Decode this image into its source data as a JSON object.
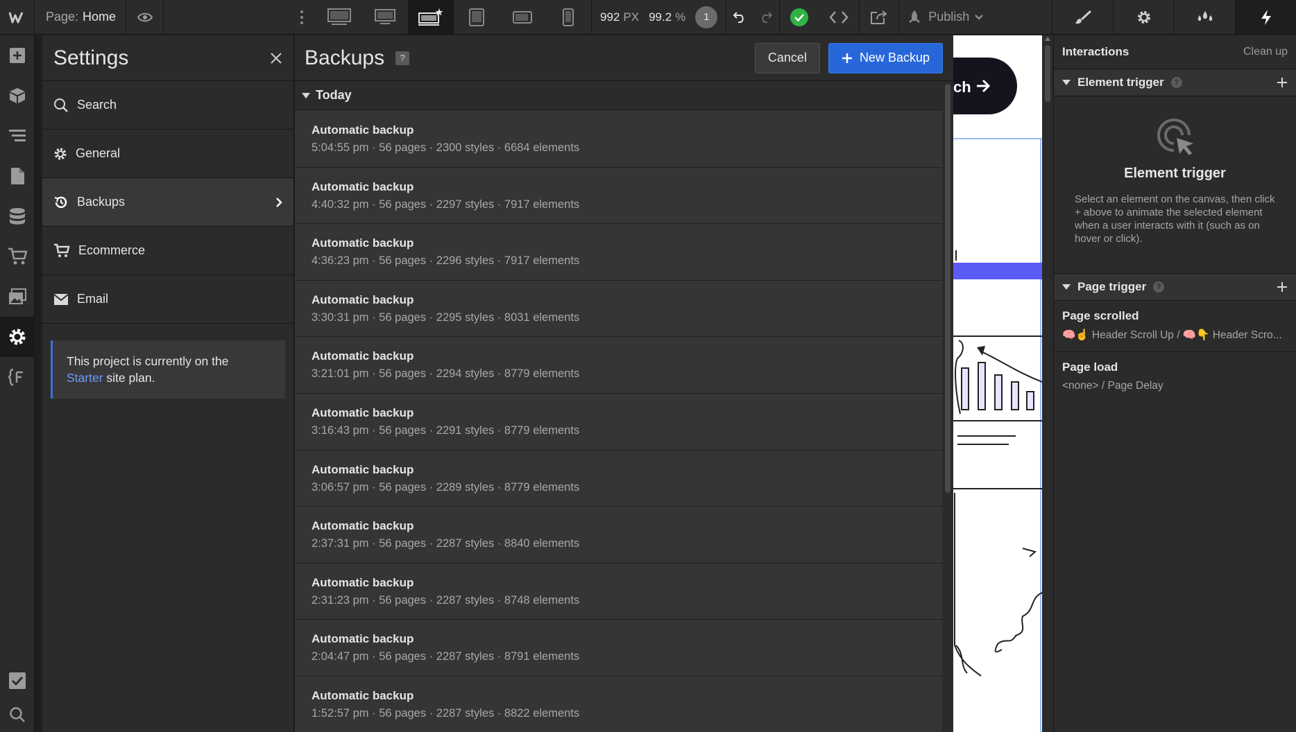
{
  "topbar": {
    "page_label": "Page:",
    "page_name": "Home",
    "width_value": "992",
    "width_unit": "PX",
    "zoom_value": "99.2",
    "zoom_unit": "%",
    "badge_count": "1",
    "publish_label": "Publish",
    "devices": [
      "desktop-large-icon",
      "desktop-icon",
      "desktop-base-icon",
      "tablet-icon",
      "mobile-landscape-icon",
      "mobile-portrait-icon"
    ],
    "active_device": "desktop-base-icon"
  },
  "rail": {
    "items": [
      "add-icon",
      "components-icon",
      "navigator-icon",
      "pages-icon",
      "cms-icon",
      "ecommerce-icon",
      "assets-icon",
      "settings-icon",
      "variables-icon"
    ],
    "bottom": [
      "audit-check-icon",
      "search-icon"
    ]
  },
  "settings": {
    "title": "Settings",
    "items": [
      {
        "label": "Search",
        "icon": "search-icon"
      },
      {
        "label": "General",
        "icon": "gear-icon"
      },
      {
        "label": "Backups",
        "icon": "history-icon",
        "active": true
      },
      {
        "label": "Ecommerce",
        "icon": "cart-icon"
      },
      {
        "label": "Email",
        "icon": "mail-icon"
      }
    ],
    "plan_prefix": "This project is currently on the",
    "plan_link": "Starter",
    "plan_suffix": "site plan."
  },
  "backups": {
    "title": "Backups",
    "help": "?",
    "cancel_label": "Cancel",
    "new_label": "New Backup",
    "group_label": "Today",
    "rows": [
      {
        "name": "Automatic backup",
        "meta": "5:04:55 pm · 56 pages · 2300 styles · 6684 elements"
      },
      {
        "name": "Automatic backup",
        "meta": "4:40:32 pm · 56 pages · 2297 styles · 7917 elements"
      },
      {
        "name": "Automatic backup",
        "meta": "4:36:23 pm · 56 pages · 2296 styles · 7917 elements"
      },
      {
        "name": "Automatic backup",
        "meta": "3:30:31 pm · 56 pages · 2295 styles · 8031 elements"
      },
      {
        "name": "Automatic backup",
        "meta": "3:21:01 pm · 56 pages · 2294 styles · 8779 elements"
      },
      {
        "name": "Automatic backup",
        "meta": "3:16:43 pm · 56 pages · 2291 styles · 8779 elements"
      },
      {
        "name": "Automatic backup",
        "meta": "3:06:57 pm · 56 pages · 2289 styles · 8779 elements"
      },
      {
        "name": "Automatic backup",
        "meta": "2:37:31 pm · 56 pages · 2287 styles · 8840 elements"
      },
      {
        "name": "Automatic backup",
        "meta": "2:31:23 pm · 56 pages · 2287 styles · 8748 elements"
      },
      {
        "name": "Automatic backup",
        "meta": "2:04:47 pm · 56 pages · 2287 styles · 8791 elements"
      },
      {
        "name": "Automatic backup",
        "meta": "1:52:57 pm · 56 pages · 2287 styles · 8822 elements"
      }
    ]
  },
  "canvas": {
    "button_text": "ch"
  },
  "interactions": {
    "title": "Interactions",
    "clean_up": "Clean up",
    "element_trigger": {
      "label": "Element trigger",
      "empty_title": "Element trigger",
      "empty_desc": "Select an element on the canvas, then click + above to animate the selected element when a user interacts with it (such as on hover or click)."
    },
    "page_trigger": {
      "label": "Page trigger",
      "items": [
        {
          "name": "Page scrolled",
          "sub": "🧠☝ Header Scroll Up / 🧠👇 Header Scro..."
        },
        {
          "name": "Page load",
          "sub": "<none> / Page Delay"
        }
      ]
    }
  },
  "colors": {
    "accent": "#2767d9",
    "link": "#6e9bff",
    "success": "#2fb344",
    "canvas_bar": "#5b5bf5"
  }
}
